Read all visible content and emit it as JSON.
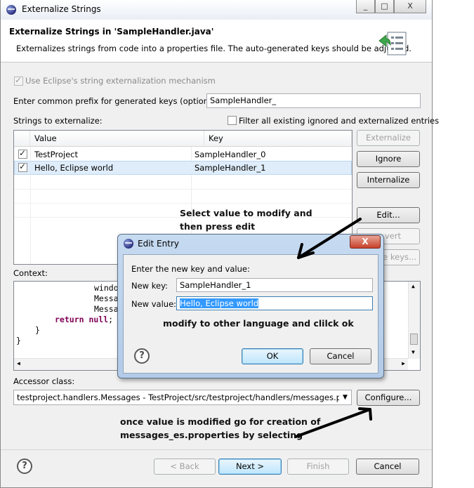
{
  "window": {
    "title": "Externalize Strings",
    "caption_buttons": [
      "_",
      "□",
      "X"
    ]
  },
  "header": {
    "title": "Externalize Strings in 'SampleHandler.java'",
    "description": "Externalizes strings from code into a properties file. The auto-generated keys should be adjusted."
  },
  "options": {
    "use_eclipse_mechanism": "Use Eclipse's string externalization mechanism",
    "prefix_label": "Enter common prefix for generated keys (optional):",
    "prefix_value": "SampleHandler_",
    "strings_label": "Strings to externalize:",
    "filter_label": "Filter all existing ignored and externalized entries"
  },
  "table": {
    "columns": [
      "Value",
      "Key"
    ],
    "rows": [
      {
        "value": "TestProject",
        "key": "SampleHandler_0"
      },
      {
        "value": "Hello, Eclipse world",
        "key": "SampleHandler_1"
      }
    ]
  },
  "side_buttons": {
    "externalize": "Externalize",
    "ignore": "Ignore",
    "internalize": "Internalize",
    "edit": "Edit...",
    "revert_partial": "vert",
    "keys_partial": "e keys..."
  },
  "context": {
    "label": "Context:",
    "lines": [
      "window",
      "Messag",
      "Messag",
      "return null;",
      "}",
      "}"
    ]
  },
  "accessor": {
    "label": "Accessor class:",
    "value": "testproject.handlers.Messages - TestProject/src/testproject/handlers/messages.properti",
    "configure": "Configure..."
  },
  "footer": {
    "back": "< Back",
    "next": "Next >",
    "finish": "Finish",
    "cancel": "Cancel"
  },
  "dialog": {
    "title": "Edit Entry",
    "close": "X",
    "instruction": "Enter the new key and value:",
    "key_label": "New key:",
    "key_value": "SampleHandler_1",
    "value_label": "New value:",
    "value_value": "Hello, Eclipse world",
    "ok": "OK",
    "cancel": "Cancel"
  },
  "annotations": {
    "select_line1": "Select value to modify and",
    "select_line2": "then press edit",
    "modify": "modify to other language and clilck ok",
    "once_line1": "once value is modified  go for creation of",
    "once_line2": "messages_es.properties by selecting"
  }
}
